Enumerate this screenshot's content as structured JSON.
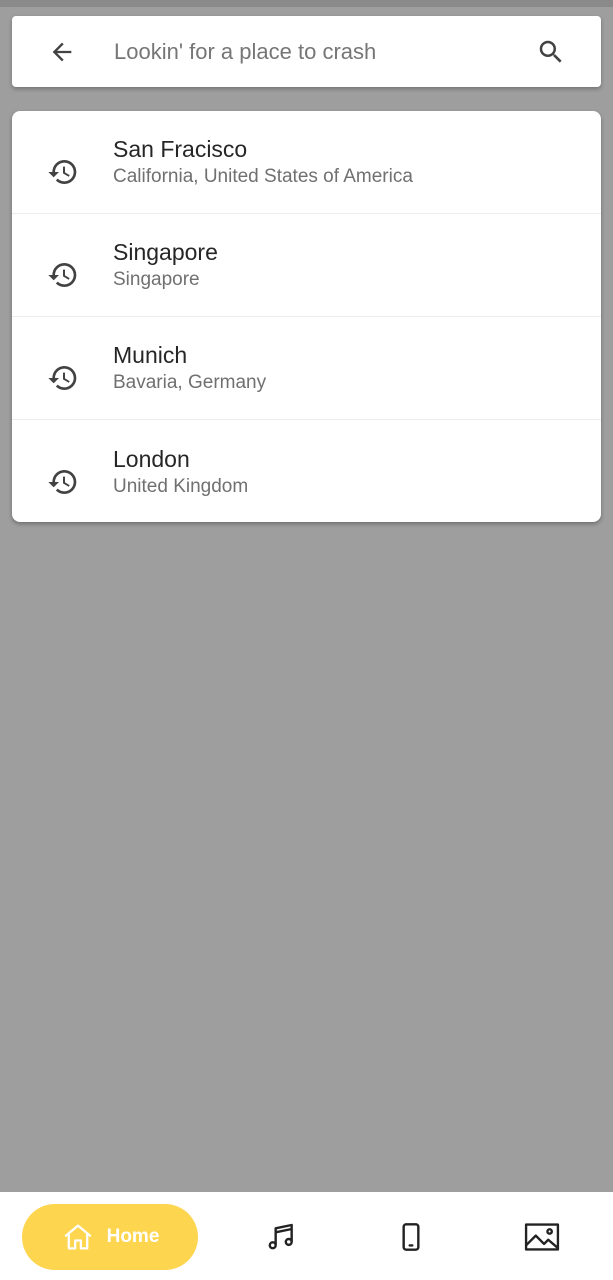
{
  "search": {
    "placeholder": "Lookin' for a place to crash",
    "back_icon": "arrow-left-icon",
    "search_icon": "search-icon"
  },
  "history": [
    {
      "title": "San Fracisco",
      "subtitle": "California, United States of America",
      "icon": "history-icon"
    },
    {
      "title": "Singapore",
      "subtitle": "Singapore",
      "icon": "history-icon"
    },
    {
      "title": "Munich",
      "subtitle": "Bavaria, Germany",
      "icon": "history-icon"
    },
    {
      "title": "London",
      "subtitle": "United Kingdom",
      "icon": "history-icon"
    }
  ],
  "bottom_nav": {
    "home_label": "Home",
    "items": [
      "home-icon",
      "music-icon",
      "phone-icon",
      "image-icon"
    ],
    "active_color": "#fdd54f"
  },
  "colors": {
    "background": "#9e9e9e",
    "accent": "#fdd54f"
  }
}
